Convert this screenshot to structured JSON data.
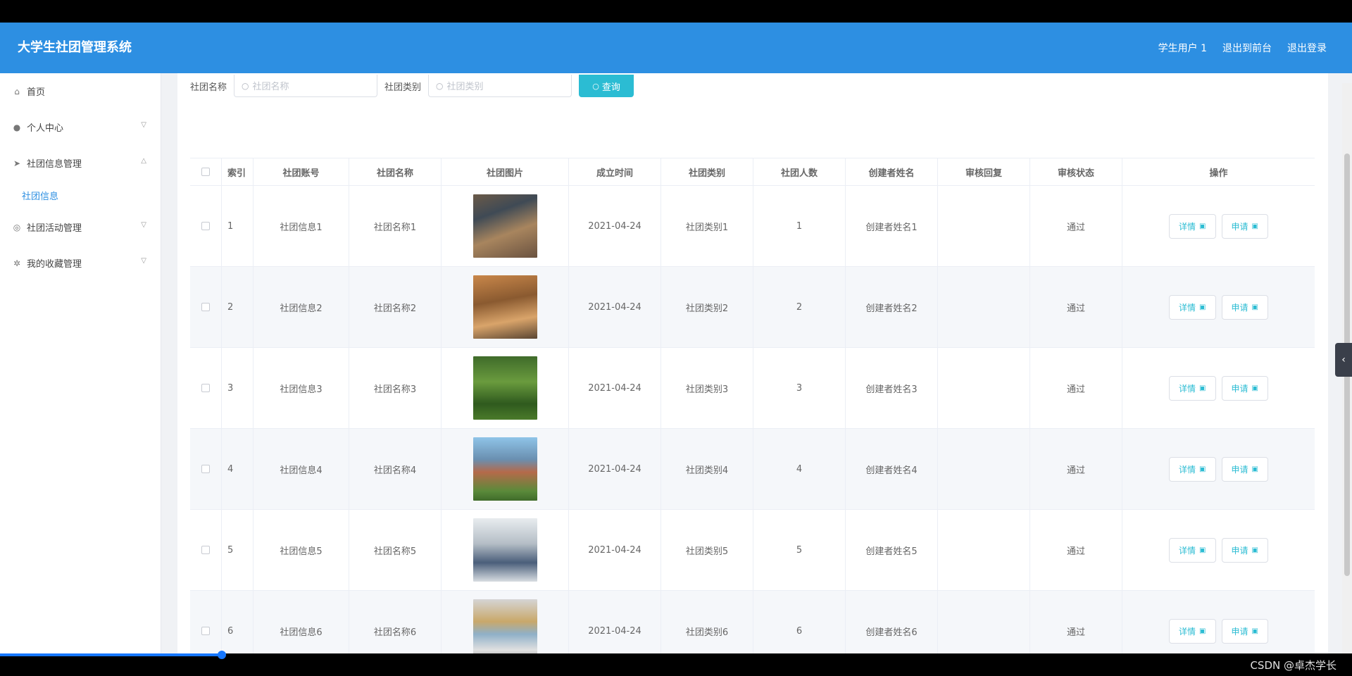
{
  "header": {
    "title": "大学生社团管理系统",
    "user": "学生用户 1",
    "back_front": "退出到前台",
    "logout": "退出登录"
  },
  "sidebar": {
    "items": [
      {
        "label": "首页",
        "icon": "home-icon"
      },
      {
        "label": "个人中心",
        "icon": "user-icon"
      },
      {
        "label": "社团信息管理",
        "icon": "send-icon"
      },
      {
        "sub": "社团信息"
      },
      {
        "label": "社团活动管理",
        "icon": "circle-icon"
      },
      {
        "label": "我的收藏管理",
        "icon": "star-icon"
      }
    ]
  },
  "search": {
    "name_label": "社团名称",
    "name_placeholder": "社团名称",
    "type_label": "社团类别",
    "type_placeholder": "社团类别",
    "button": "查询"
  },
  "table": {
    "headers": [
      "索引",
      "社团账号",
      "社团名称",
      "社团图片",
      "成立时间",
      "社团类别",
      "社团人数",
      "创建者姓名",
      "审核回复",
      "审核状态",
      "操作"
    ],
    "rows": [
      {
        "idx": "1",
        "account": "社团信息1",
        "name": "社团名称1",
        "date": "2021-04-24",
        "type": "社团类别1",
        "num": "1",
        "creator": "创建者姓名1",
        "reply": "",
        "status": "通过"
      },
      {
        "idx": "2",
        "account": "社团信息2",
        "name": "社团名称2",
        "date": "2021-04-24",
        "type": "社团类别2",
        "num": "2",
        "creator": "创建者姓名2",
        "reply": "",
        "status": "通过"
      },
      {
        "idx": "3",
        "account": "社团信息3",
        "name": "社团名称3",
        "date": "2021-04-24",
        "type": "社团类别3",
        "num": "3",
        "creator": "创建者姓名3",
        "reply": "",
        "status": "通过"
      },
      {
        "idx": "4",
        "account": "社团信息4",
        "name": "社团名称4",
        "date": "2021-04-24",
        "type": "社团类别4",
        "num": "4",
        "creator": "创建者姓名4",
        "reply": "",
        "status": "通过"
      },
      {
        "idx": "5",
        "account": "社团信息5",
        "name": "社团名称5",
        "date": "2021-04-24",
        "type": "社团类别5",
        "num": "5",
        "creator": "创建者姓名5",
        "reply": "",
        "status": "通过"
      },
      {
        "idx": "6",
        "account": "社团信息6",
        "name": "社团名称6",
        "date": "2021-04-24",
        "type": "社团类别6",
        "num": "6",
        "creator": "创建者姓名6",
        "reply": "",
        "status": "通过"
      }
    ],
    "ops": {
      "detail": "详情",
      "apply": "申请"
    }
  },
  "watermark": "CSDN @卓杰学长",
  "colors": {
    "header": "#2d8fe2",
    "button": "#2bbcd3"
  }
}
